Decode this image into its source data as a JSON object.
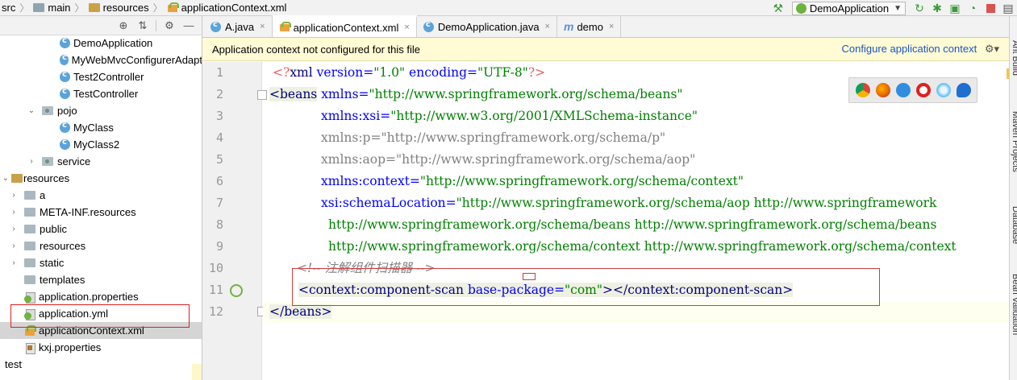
{
  "breadcrumb": {
    "items": [
      "src",
      "main",
      "resources",
      "applicationContext.xml"
    ]
  },
  "toolbar": {
    "run_config": "DemoApplication"
  },
  "project_tree": {
    "items": [
      {
        "label": "DemoApplication",
        "type": "class"
      },
      {
        "label": "MyWebMvcConfigurerAdapt",
        "type": "class"
      },
      {
        "label": "Test2Controller",
        "type": "class"
      },
      {
        "label": "TestController",
        "type": "class"
      },
      {
        "label": "pojo",
        "type": "package",
        "expanded": true
      },
      {
        "label": "MyClass",
        "type": "class"
      },
      {
        "label": "MyClass2",
        "type": "class"
      },
      {
        "label": "service",
        "type": "package",
        "expanded": false
      },
      {
        "label": "resources",
        "type": "resource-root",
        "expanded": true
      },
      {
        "label": "a",
        "type": "folder",
        "expanded": false
      },
      {
        "label": "META-INF.resources",
        "type": "folder",
        "expanded": false
      },
      {
        "label": "public",
        "type": "folder",
        "expanded": false
      },
      {
        "label": "resources",
        "type": "folder",
        "expanded": false
      },
      {
        "label": "static",
        "type": "folder",
        "expanded": false
      },
      {
        "label": "templates",
        "type": "folder"
      },
      {
        "label": "application.properties",
        "type": "properties"
      },
      {
        "label": "application.yml",
        "type": "yml"
      },
      {
        "label": "applicationContext.xml",
        "type": "xml",
        "selected": true
      },
      {
        "label": "kxj.properties",
        "type": "kxj"
      },
      {
        "label": "test",
        "type": "folder",
        "expanded": false
      }
    ]
  },
  "tabs": [
    {
      "label": "A.java",
      "icon": "class-icon",
      "active": false
    },
    {
      "label": "applicationContext.xml",
      "icon": "xml-icon",
      "active": true
    },
    {
      "label": "DemoApplication.java",
      "icon": "class-icon",
      "active": false
    },
    {
      "label": "demo",
      "icon": "maven-icon",
      "active": false
    }
  ],
  "banner": {
    "message": "Application context not configured for this file",
    "link": "Configure application context"
  },
  "editor": {
    "line_numbers": [
      "1",
      "2",
      "3",
      "4",
      "5",
      "6",
      "7",
      "8",
      "9",
      "10",
      "11",
      "12"
    ],
    "lines": {
      "l1_open": "<?",
      "l1_tag": "xml",
      "l1_attr1": " version=",
      "l1_val1": "\"1.0\"",
      "l1_attr2": " encoding=",
      "l1_val2": "\"UTF-8\"",
      "l1_close": "?>",
      "l2_tag": "<beans",
      "l2_attr": " xmlns=",
      "l2_val": "\"http://www.springframework.org/schema/beans\"",
      "l3_attr": "xmlns:xsi=",
      "l3_val": "\"http://www.w3.org/2001/XMLSchema-instance\"",
      "l4_attr": "xmlns:p=",
      "l4_val": "\"http://www.springframework.org/schema/p\"",
      "l5_attr": "xmlns:aop=",
      "l5_val": "\"http://www.springframework.org/schema/aop\"",
      "l6_attr": "xmlns:context=",
      "l6_val": "\"http://www.springframework.org/schema/context\"",
      "l7_attr": "xsi:schemaLocation=",
      "l7_val": "\"http://www.springframework.org/schema/aop http://www.springframework",
      "l8_val": "http://www.springframework.org/schema/beans http://www.springframework.org/schema/beans",
      "l9_val": "http://www.springframework.org/schema/context http://www.springframework.org/schema/context",
      "l10_comment": "<!-- 注解组件扫描器 -->",
      "l11_open": "<context:component-scan",
      "l11_attr": " base-package=",
      "l11_val": "\"com\"",
      "l11_close": "></context:component-scan>",
      "l12_tag": "</beans>"
    }
  },
  "right_strip": {
    "labels": [
      "Ant Build",
      "Maven Projects",
      "Database",
      "Bean Validation"
    ]
  },
  "colors": {
    "tag": "#000080",
    "attribute": "#0000ff",
    "value": "#008000",
    "comment": "#808080",
    "banner_bg": "#fffbd4",
    "annotation_box": "#d23a3a"
  }
}
